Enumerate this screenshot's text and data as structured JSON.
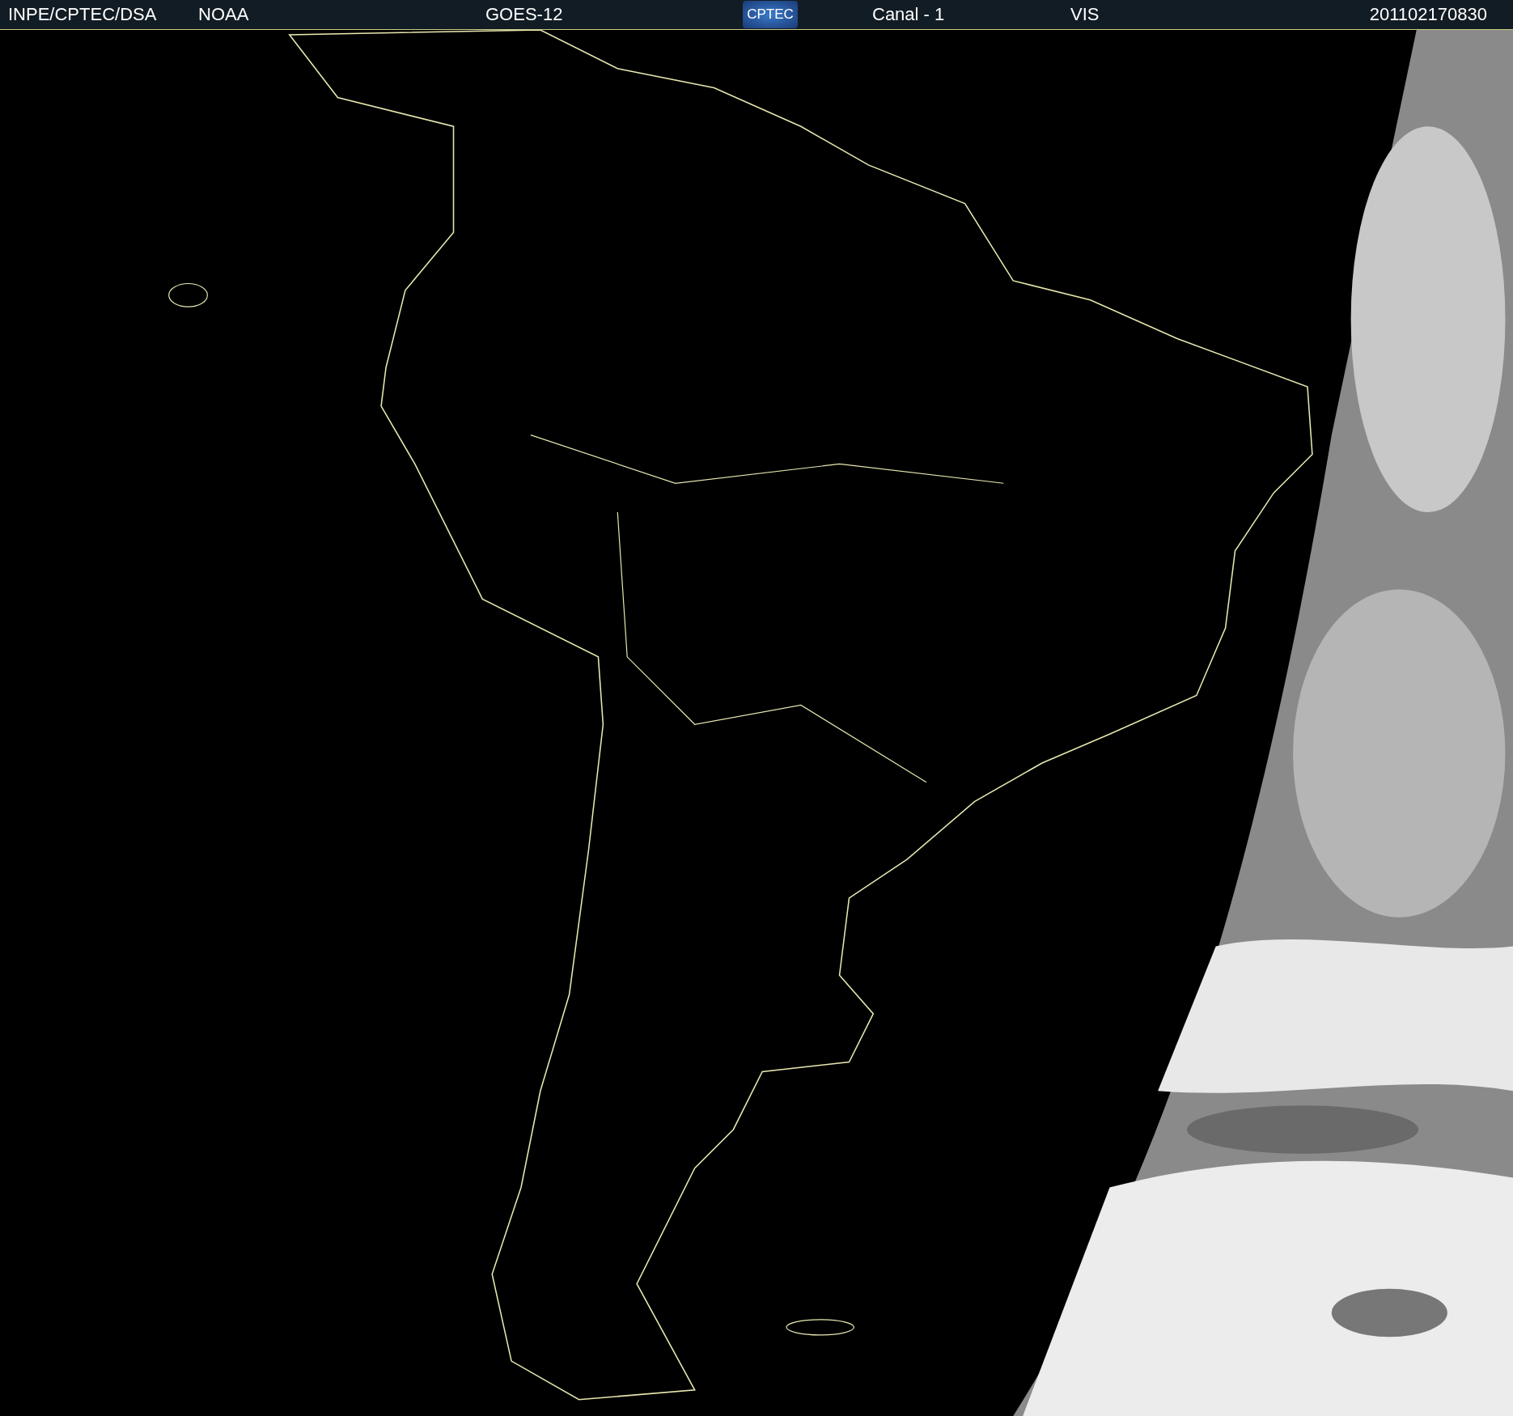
{
  "header": {
    "source": "INPE/CPTEC/DSA",
    "agency": "NOAA",
    "satellite": "GOES-12",
    "logo_text": "CPTEC",
    "channel": "Canal - 1",
    "band": "VIS",
    "timestamp": "201102170830"
  }
}
